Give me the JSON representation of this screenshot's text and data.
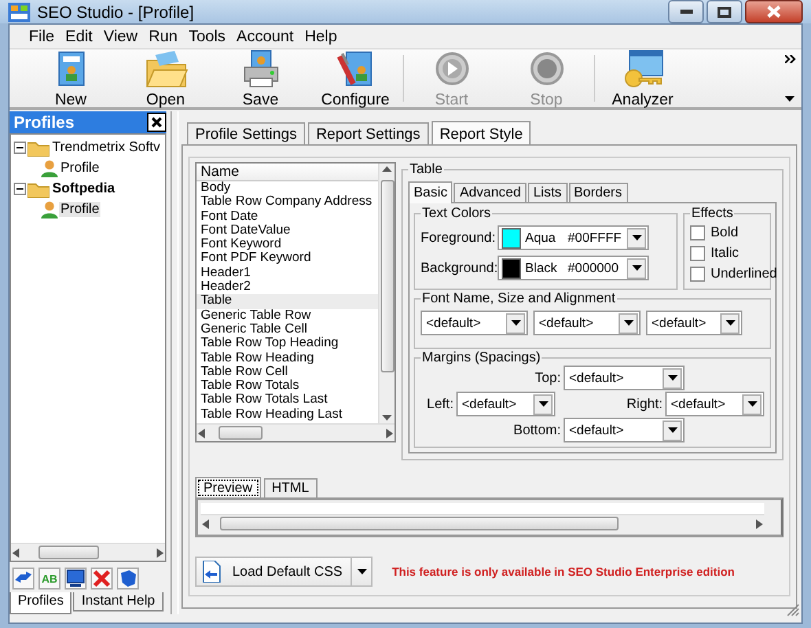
{
  "window": {
    "title": "SEO Studio - [Profile]"
  },
  "menu": [
    "File",
    "Edit",
    "View",
    "Run",
    "Tools",
    "Account",
    "Help"
  ],
  "toolbar": [
    {
      "label": "New",
      "kind": "new",
      "disabled": false
    },
    {
      "label": "Open",
      "kind": "open",
      "disabled": false
    },
    {
      "label": "Save",
      "kind": "save",
      "disabled": false
    },
    {
      "label": "Configure",
      "kind": "configure",
      "disabled": false
    },
    {
      "label": "Start",
      "kind": "start",
      "disabled": true
    },
    {
      "label": "Stop",
      "kind": "stop",
      "disabled": true
    },
    {
      "label": "Analyzer",
      "kind": "analyzer",
      "disabled": false
    }
  ],
  "profiles_panel": {
    "title": "Profiles",
    "tree": [
      {
        "label": "Trendmetrix Softv",
        "bold": false,
        "expanded": true,
        "children": [
          {
            "label": "Profile",
            "selected": false
          }
        ]
      },
      {
        "label": "Softpedia",
        "bold": true,
        "expanded": true,
        "children": [
          {
            "label": "Profile",
            "selected": true
          }
        ]
      }
    ],
    "tools": [
      {
        "kind": "swap"
      },
      {
        "kind": "text",
        "label": "AB"
      },
      {
        "kind": "monitor"
      },
      {
        "kind": "delete"
      },
      {
        "kind": "shield"
      }
    ],
    "tabs": [
      {
        "label": "Profiles",
        "selected": true
      },
      {
        "label": "Instant Help",
        "selected": false
      }
    ]
  },
  "tabs": [
    {
      "label": "Profile Settings",
      "selected": false
    },
    {
      "label": "Report Settings",
      "selected": false
    },
    {
      "label": "Report Style",
      "selected": true
    }
  ],
  "style_list": {
    "column": "Name",
    "items": [
      {
        "label": "Body",
        "selected": false
      },
      {
        "label": "Table Row Company Address",
        "selected": false
      },
      {
        "label": "Font Date",
        "selected": false
      },
      {
        "label": "Font DateValue",
        "selected": false
      },
      {
        "label": "Font Keyword",
        "selected": false
      },
      {
        "label": "Font PDF Keyword",
        "selected": false
      },
      {
        "label": "Header1",
        "selected": false
      },
      {
        "label": "Header2",
        "selected": false
      },
      {
        "label": "Table",
        "selected": true
      },
      {
        "label": "Generic Table Row",
        "selected": false
      },
      {
        "label": "Generic Table Cell",
        "selected": false
      },
      {
        "label": "Table Row Top Heading",
        "selected": false
      },
      {
        "label": "Table Row Heading",
        "selected": false
      },
      {
        "label": "Table Row Cell",
        "selected": false
      },
      {
        "label": "Table Row Totals",
        "selected": false
      },
      {
        "label": "Table Row Totals Last",
        "selected": false
      },
      {
        "label": "Table Row Heading Last",
        "selected": false
      }
    ]
  },
  "style_group": {
    "title": "Table",
    "tabs": [
      {
        "label": "Basic",
        "selected": true
      },
      {
        "label": "Advanced",
        "selected": false
      },
      {
        "label": "Lists",
        "selected": false
      },
      {
        "label": "Borders",
        "selected": false
      }
    ],
    "text_colors": {
      "title": "Text Colors",
      "rows": [
        {
          "label": "Foreground:",
          "color": "#00ffff",
          "name": "Aqua",
          "hex": "#00FFFF"
        },
        {
          "label": "Background:",
          "color": "#000000",
          "name": "Black",
          "hex": "#000000"
        }
      ]
    },
    "effects": {
      "title": "Effects",
      "options": [
        {
          "label": "Bold",
          "checked": false
        },
        {
          "label": "Italic",
          "checked": false
        },
        {
          "label": "Underlined",
          "checked": false
        }
      ]
    },
    "font": {
      "title": "Font Name, Size and Alignment",
      "dropdowns": [
        "<default>",
        "<default>",
        "<default>"
      ]
    },
    "margins": {
      "title": "Margins (Spacings)",
      "fields": [
        {
          "label": "Top:",
          "value": "<default>"
        },
        {
          "label": "Left:",
          "value": "<default>"
        },
        {
          "label": "Right:",
          "value": "<default>"
        },
        {
          "label": "Bottom:",
          "value": "<default>"
        }
      ]
    }
  },
  "preview": {
    "tabs": [
      {
        "label": "Preview",
        "selected": true
      },
      {
        "label": "HTML",
        "selected": false
      }
    ]
  },
  "load_button": {
    "label": "Load Default CSS"
  },
  "notice": "This feature is only available in SEO Studio Enterprise edition"
}
